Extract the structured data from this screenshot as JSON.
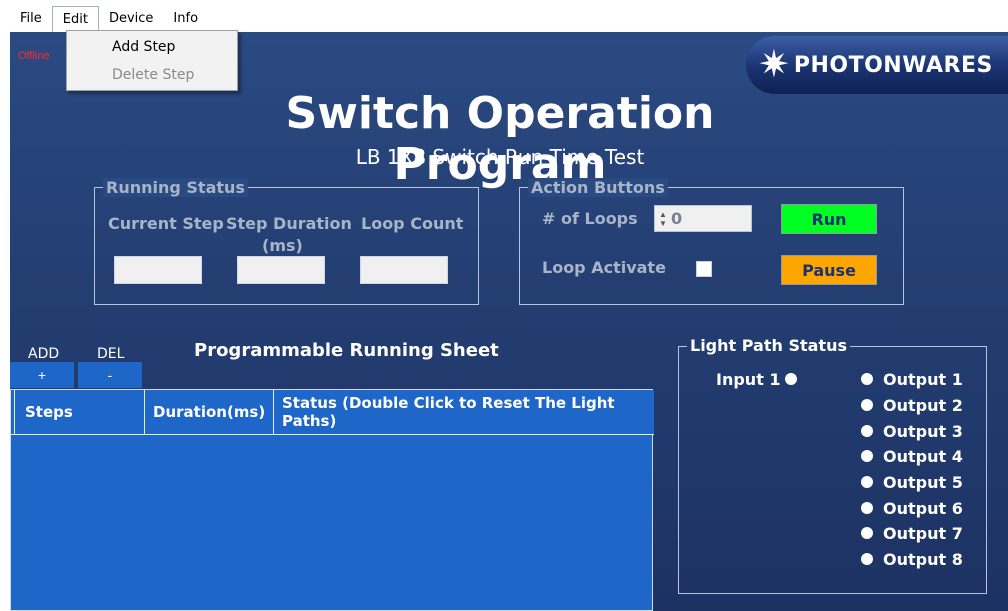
{
  "menu": {
    "file": "File",
    "edit": "Edit",
    "device": "Device",
    "info": "Info"
  },
  "edit_menu": {
    "add_step": "Add Step",
    "delete_step": "Delete Step"
  },
  "status": {
    "offline": "Offline"
  },
  "logo": {
    "text": "PHOTONWARES"
  },
  "header": {
    "title": "Switch Operation Program",
    "subtitle": "LB 1X8 Switch Run Time Test"
  },
  "running_status": {
    "title": "Running Status",
    "current_step": "Current Step",
    "step_duration": "Step Duration",
    "step_duration_unit": "(ms)",
    "loop_count": "Loop Count",
    "current_step_value": "",
    "step_duration_value": "",
    "loop_count_value": ""
  },
  "action_buttons": {
    "title": "Action Buttons",
    "loops_label": "# of Loops",
    "loops_value": "0",
    "loop_activate_label": "Loop Activate",
    "run": "Run",
    "pause": "Pause"
  },
  "sheet": {
    "add_label": "ADD",
    "add_button": "+",
    "del_label": "DEL",
    "del_button": "-",
    "title": "Programmable Running Sheet",
    "columns": [
      "Steps",
      "Duration(ms)",
      "Status (Double Click to Reset The Light Paths)"
    ]
  },
  "light_path": {
    "title": "Light Path Status",
    "input": "Input 1",
    "outputs": [
      "Output 1",
      "Output 2",
      "Output 3",
      "Output 4",
      "Output 5",
      "Output 6",
      "Output 7",
      "Output 8"
    ]
  },
  "colors": {
    "run": "#00ff22",
    "pause": "#ffa500",
    "grid": "#1f66c9",
    "background": "#243f73",
    "offline": "#ff2a2a"
  }
}
